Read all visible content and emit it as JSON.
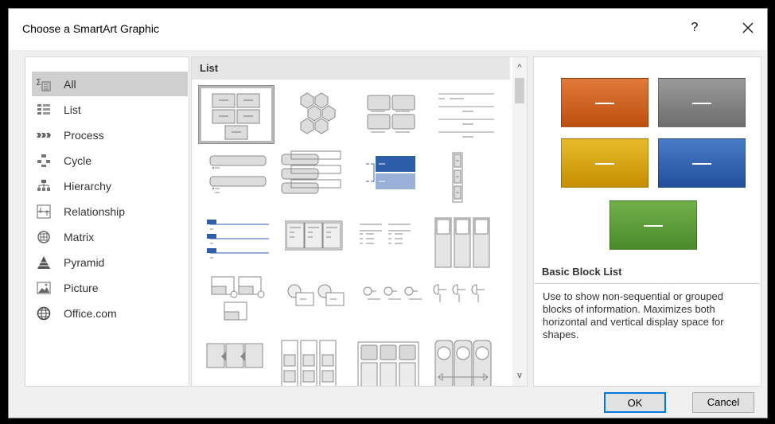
{
  "window": {
    "title": "Choose a SmartArt Graphic",
    "help_label": "?",
    "close_icon": "close-icon"
  },
  "categories": [
    {
      "label": "All",
      "icon": "all-icon",
      "selected": true
    },
    {
      "label": "List",
      "icon": "list-icon"
    },
    {
      "label": "Process",
      "icon": "process-icon"
    },
    {
      "label": "Cycle",
      "icon": "cycle-icon"
    },
    {
      "label": "Hierarchy",
      "icon": "hierarchy-icon"
    },
    {
      "label": "Relationship",
      "icon": "relationship-icon"
    },
    {
      "label": "Matrix",
      "icon": "matrix-icon"
    },
    {
      "label": "Pyramid",
      "icon": "pyramid-icon"
    },
    {
      "label": "Picture",
      "icon": "picture-icon"
    },
    {
      "label": "Office.com",
      "icon": "globe-icon"
    }
  ],
  "gallery": {
    "header": "List",
    "scroll_up": "^",
    "scroll_down": "v"
  },
  "preview": {
    "title": "Basic Block List",
    "description": "Use to show non-sequential or grouped blocks of information. Maximizes both horizontal and vertical display space for shapes.",
    "colors": [
      "#d0601c",
      "#7f7f7f",
      "#d7a100",
      "#2c5ea8",
      "#5e9a3a"
    ]
  },
  "buttons": {
    "ok": "OK",
    "cancel": "Cancel"
  }
}
